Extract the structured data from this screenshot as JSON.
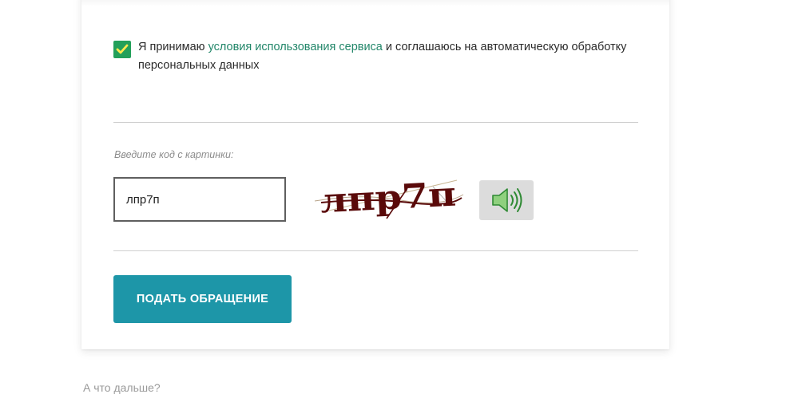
{
  "consent": {
    "checked": true,
    "text_before": "Я принимаю ",
    "link": "условия использования сервиса",
    "text_after": " и соглашаюсь на автоматическую обработку персональных данных"
  },
  "captcha": {
    "label": "Введите код с картинки:",
    "input_value": "лпр7п",
    "image_text": "лпр7п"
  },
  "audio": {
    "icon": "speaker-icon"
  },
  "submit": {
    "label": "ПОДАТЬ ОБРАЩЕНИЕ"
  },
  "below": {
    "text": "А что дальше?"
  },
  "colors": {
    "checkbox": "#23a05a",
    "link": "#23876a",
    "button": "#1d96a8",
    "captcha_text": "#5a0a0a"
  }
}
